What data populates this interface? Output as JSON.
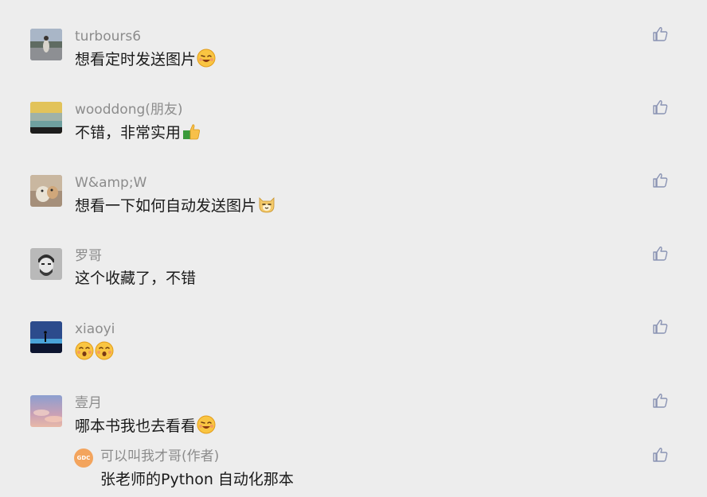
{
  "comments": [
    {
      "author": "turbours6",
      "text": "想看定时发送图片",
      "emojis": [
        "grin-wink-emoji"
      ]
    },
    {
      "author": "wooddong(朋友)",
      "text": "不错，非常实用",
      "emojis": [
        "thumbs-up-emoji"
      ]
    },
    {
      "author": "W&amp;W",
      "text": "想看一下如何自动发送图片",
      "emojis": [
        "cat-face-emoji"
      ]
    },
    {
      "author": "罗哥",
      "text": "这个收藏了，不错",
      "emojis": []
    },
    {
      "author": "xiaoyi",
      "text": "",
      "emojis": [
        "kiss-face-emoji",
        "kiss-face-emoji"
      ]
    },
    {
      "author": "壹月",
      "text": "哪本书我也去看看",
      "emojis": [
        "grin-wink-emoji"
      ]
    }
  ],
  "reply": {
    "avatar_text": "GDC",
    "author": "可以叫我才哥(作者)",
    "text": "张老师的Python 自动化那本"
  },
  "icons": {
    "like": "thumbs-up-outline-icon"
  },
  "colors": {
    "background": "#ededed",
    "author": "#8c8c8c",
    "text": "#1a1a1a",
    "like_icon": "#8a93b3",
    "reply_avatar": "#f3a45d"
  }
}
